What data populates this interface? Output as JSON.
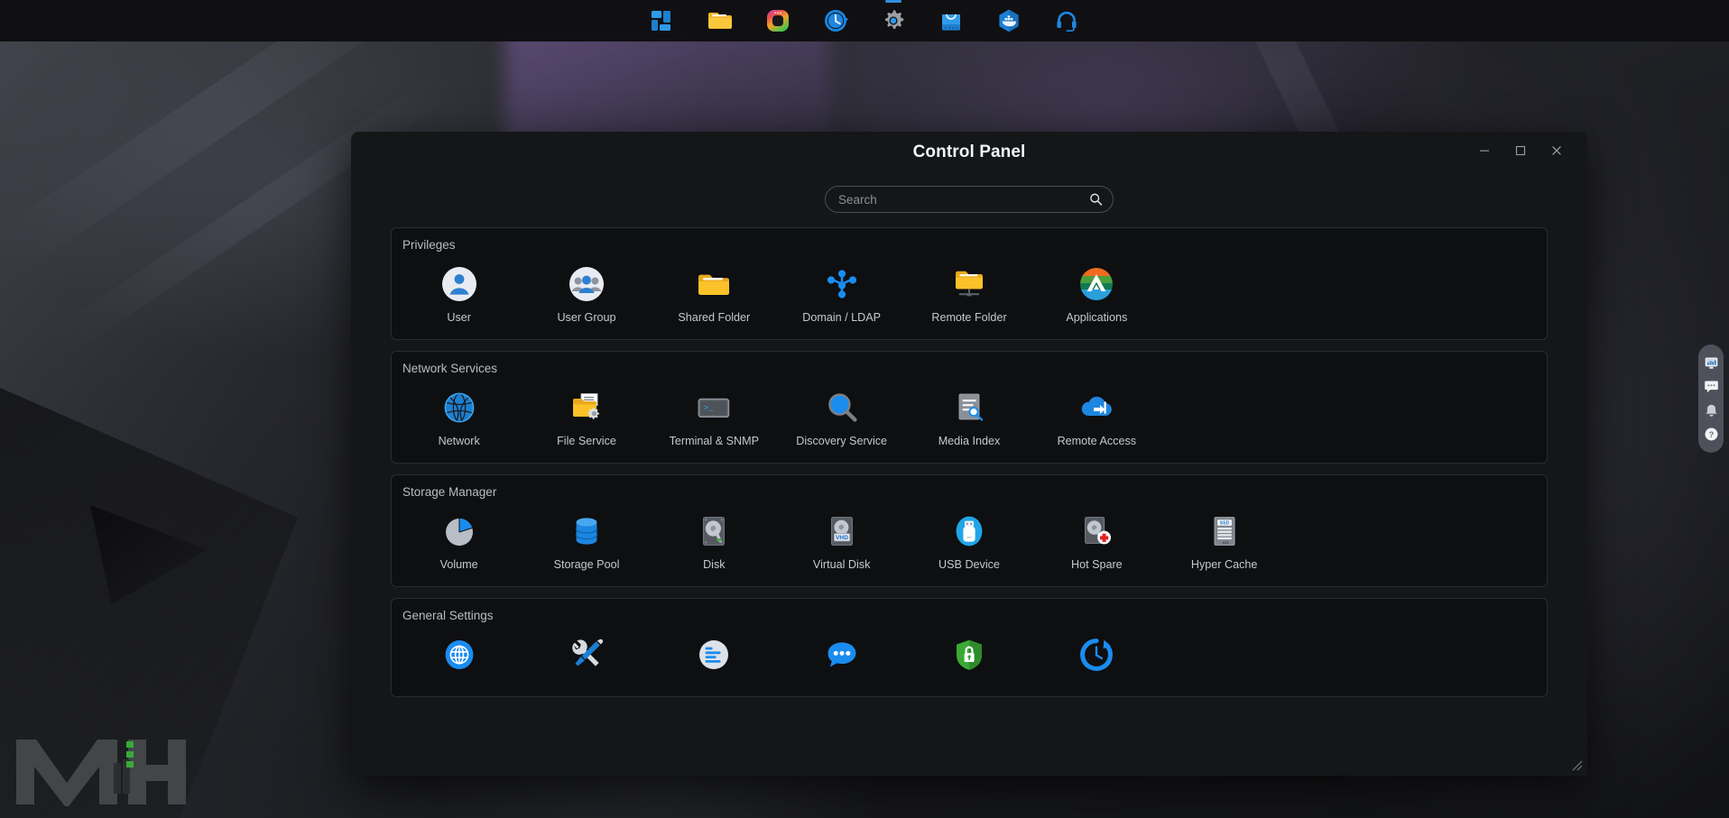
{
  "taskbar": {
    "items": [
      {
        "name": "app-dashboard",
        "label": "Dashboard",
        "icon": "windows-tiles-icon",
        "active": false
      },
      {
        "name": "app-file-station",
        "label": "File Station",
        "icon": "folder-icon",
        "active": false
      },
      {
        "name": "app-photos",
        "label": "Photos",
        "icon": "photos-icon",
        "active": false
      },
      {
        "name": "app-backup",
        "label": "Backup",
        "icon": "clock-backup-icon",
        "active": false
      },
      {
        "name": "app-control-panel",
        "label": "Control Panel",
        "icon": "gear-icon",
        "active": true
      },
      {
        "name": "app-app-center",
        "label": "App Center",
        "icon": "shopping-bag-icon",
        "active": false
      },
      {
        "name": "app-container-station",
        "label": "Container Station",
        "icon": "docker-whale-icon",
        "active": false
      },
      {
        "name": "app-support",
        "label": "Support",
        "icon": "headset-icon",
        "active": false
      }
    ]
  },
  "window": {
    "title": "Control Panel",
    "controls": {
      "minimize": "minimize-icon",
      "maximize": "maximize-icon",
      "close": "close-icon"
    },
    "resize_grip": "resize-grip-icon"
  },
  "search": {
    "value": "",
    "placeholder": "Search",
    "icon": "search-icon"
  },
  "sections": [
    {
      "title": "Privileges",
      "items": [
        {
          "label": "User",
          "icon": "user-icon"
        },
        {
          "label": "User Group",
          "icon": "user-group-icon"
        },
        {
          "label": "Shared Folder",
          "icon": "shared-folder-icon"
        },
        {
          "label": "Domain / LDAP",
          "icon": "domain-ldap-icon"
        },
        {
          "label": "Remote Folder",
          "icon": "remote-folder-icon"
        },
        {
          "label": "Applications",
          "icon": "applications-icon"
        }
      ]
    },
    {
      "title": "Network Services",
      "items": [
        {
          "label": "Network",
          "icon": "network-globe-icon"
        },
        {
          "label": "File Service",
          "icon": "file-service-icon"
        },
        {
          "label": "Terminal & SNMP",
          "icon": "terminal-icon"
        },
        {
          "label": "Discovery Service",
          "icon": "discovery-magnifier-icon"
        },
        {
          "label": "Media Index",
          "icon": "media-index-icon"
        },
        {
          "label": "Remote Access",
          "icon": "remote-access-cloud-icon"
        }
      ]
    },
    {
      "title": "Storage Manager",
      "items": [
        {
          "label": "Volume",
          "icon": "volume-pie-icon"
        },
        {
          "label": "Storage Pool",
          "icon": "storage-pool-icon"
        },
        {
          "label": "Disk",
          "icon": "disk-icon"
        },
        {
          "label": "Virtual Disk",
          "icon": "virtual-disk-vhd-icon"
        },
        {
          "label": "USB Device",
          "icon": "usb-device-icon"
        },
        {
          "label": "Hot Spare",
          "icon": "hot-spare-icon"
        },
        {
          "label": "Hyper Cache",
          "icon": "hyper-cache-ssd-icon"
        }
      ]
    },
    {
      "title": "General Settings",
      "items": [
        {
          "label": "",
          "icon": "system-globe-icon"
        },
        {
          "label": "",
          "icon": "hardware-tools-icon"
        },
        {
          "label": "",
          "icon": "system-log-icon"
        },
        {
          "label": "",
          "icon": "notification-bubble-icon"
        },
        {
          "label": "",
          "icon": "security-shield-icon"
        },
        {
          "label": "",
          "icon": "power-schedule-icon"
        }
      ]
    }
  ],
  "right_dock": {
    "items": [
      {
        "name": "resource-monitor",
        "icon": "monitor-chart-icon"
      },
      {
        "name": "chat",
        "icon": "chat-bubble-icon"
      },
      {
        "name": "notifications",
        "icon": "bell-icon"
      },
      {
        "name": "help",
        "icon": "help-question-icon"
      }
    ]
  },
  "watermark": {
    "text": "MH"
  },
  "colors": {
    "accent_blue": "#1a8cf0",
    "folder_yellow": "#fbbe28",
    "green": "#3aaa35",
    "window_bg": "#151618",
    "section_bg": "#0e0f11",
    "taskbar_bg": "#101012"
  }
}
